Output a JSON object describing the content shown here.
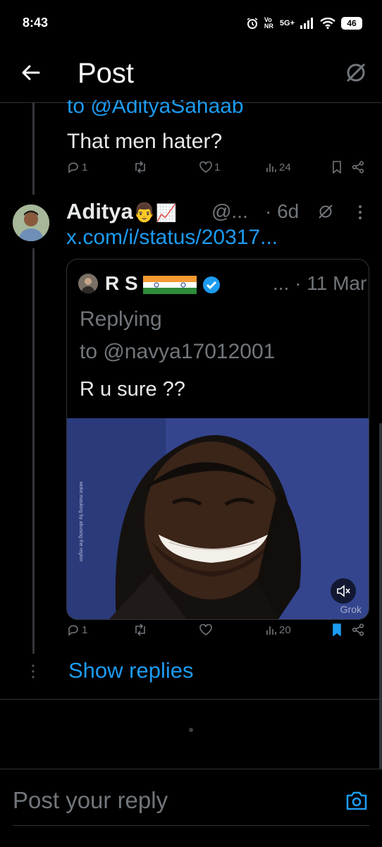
{
  "status_bar": {
    "time": "8:43",
    "network": "5G+",
    "volte": "Vo NR",
    "battery": "46"
  },
  "header": {
    "title": "Post",
    "back_icon": "arrow-left-icon",
    "grok_icon": "grok-icon"
  },
  "previous_post": {
    "mention": "to @AdityaSahaab",
    "text": "That men hater?",
    "replies": "1",
    "likes": "1",
    "views": "24"
  },
  "post": {
    "author_name": "Aditya👨🏻‍👑📈",
    "author_display": "Aditya",
    "handle": "@...",
    "time": "· 6d",
    "link": "x.com/i/status/20317...",
    "quote": {
      "name": "R S",
      "date": "... · 11 Mar",
      "replying_line1": "Replying",
      "replying_line2": "to @navya17012001",
      "text": "R u sure ??",
      "media_watermark": "Grok"
    },
    "replies": "1",
    "views": "20"
  },
  "show_replies": "Show replies",
  "reply_bar": {
    "placeholder": "Post your reply"
  },
  "colors": {
    "accent": "#1d9bf0",
    "background": "#000000",
    "text": "#e7e9ea",
    "muted": "#71767b",
    "border": "#2f3336"
  }
}
